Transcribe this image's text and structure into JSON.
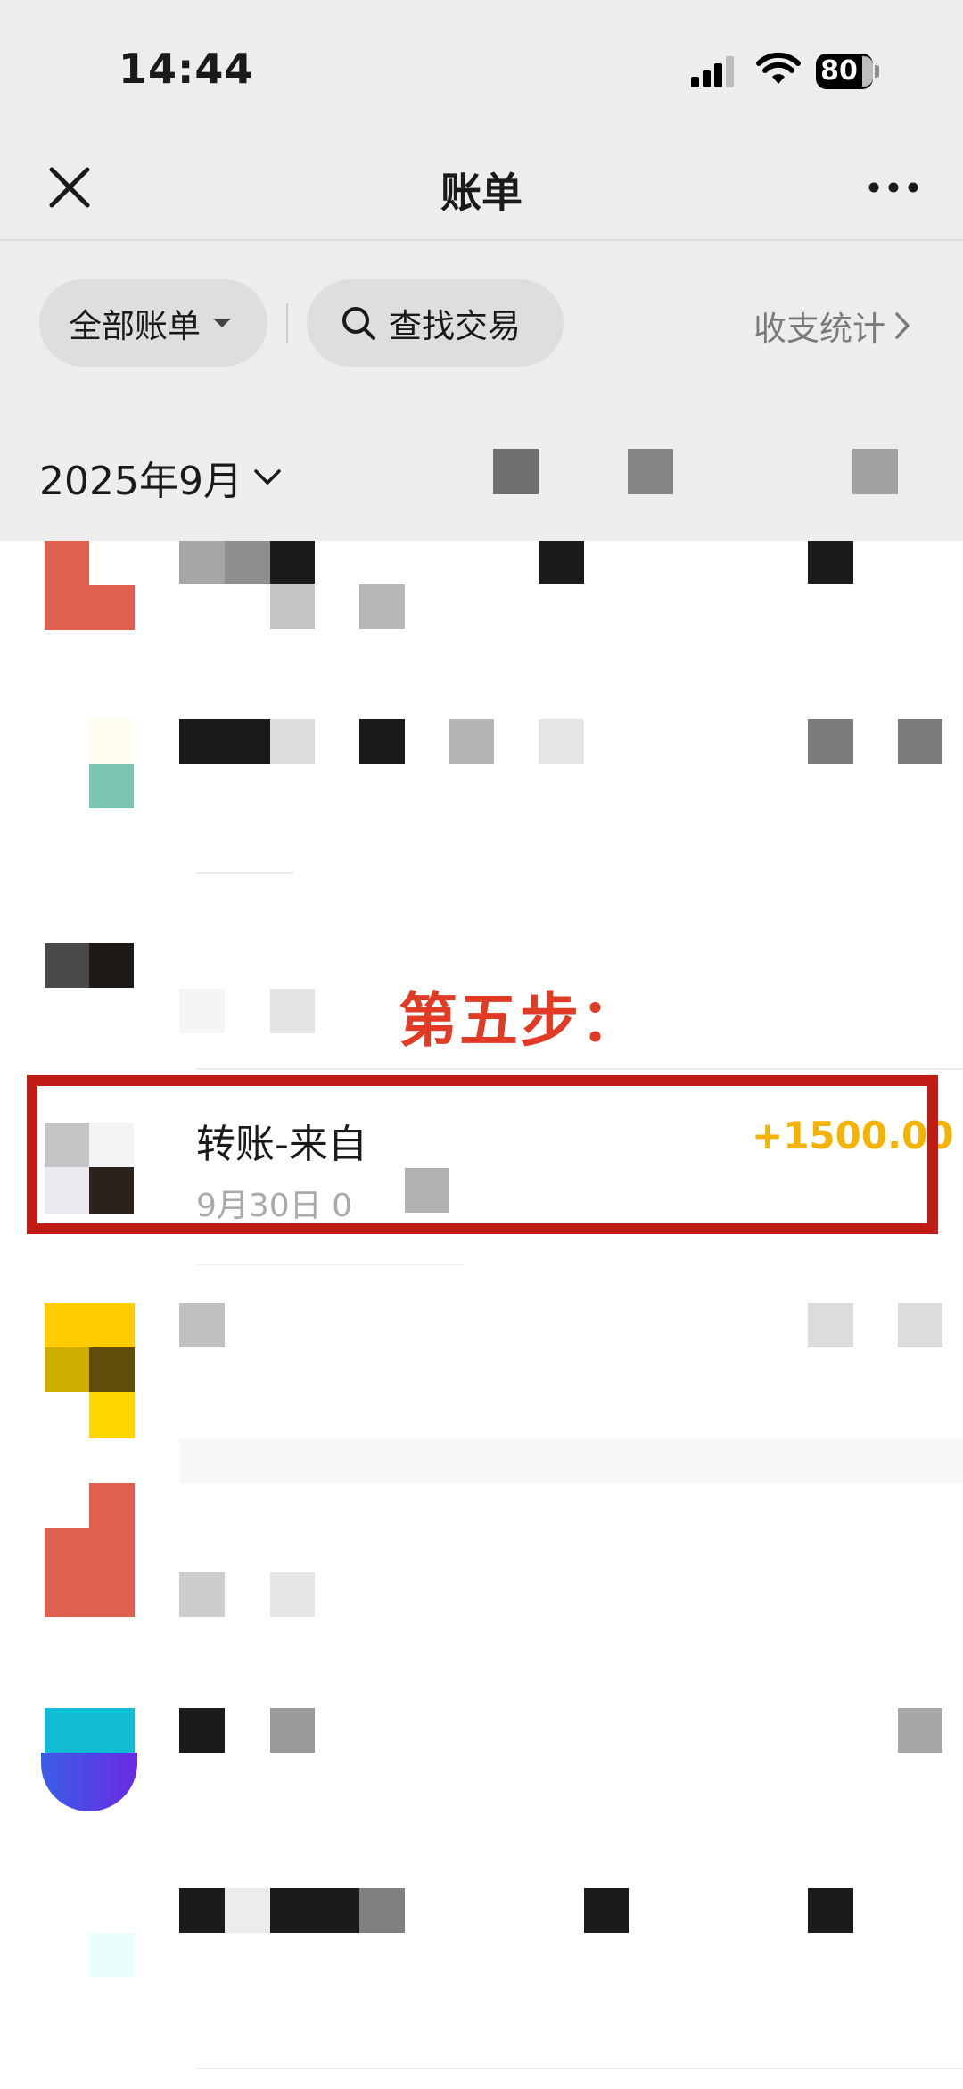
{
  "status_bar": {
    "time": "14:44",
    "battery": "80"
  },
  "nav": {
    "title": "账单"
  },
  "filters": {
    "all_bills": "全部账单",
    "search": "查找交易",
    "stats": "收支统计"
  },
  "month_selector": "2025年9月",
  "annotation": {
    "step_label": "第五步："
  },
  "highlighted_transaction": {
    "title": "转账-来自",
    "amount": "+1500.00",
    "date": "9月30日 0"
  },
  "colors": {
    "background": "#ededed",
    "amount_income": "#f5b301",
    "annotation_red": "#e13b25",
    "highlight_border": "#c01b14"
  },
  "icons": [
    "close-icon",
    "more-icon",
    "dropdown-caret-icon",
    "search-icon",
    "chevron-right-icon",
    "chevron-down-icon",
    "signal-icon",
    "wifi-icon",
    "battery-icon"
  ]
}
